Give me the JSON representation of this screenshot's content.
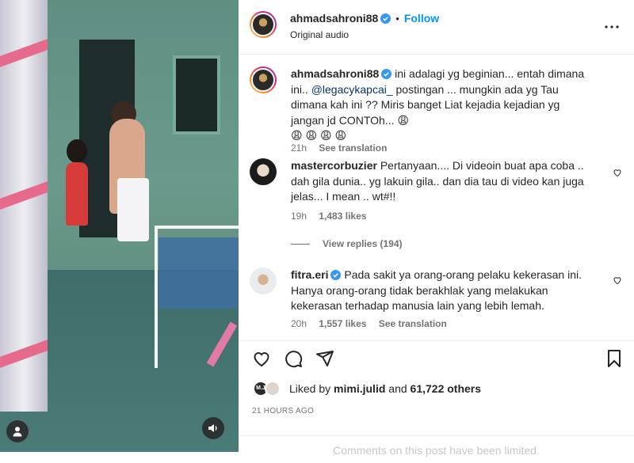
{
  "post": {
    "author": "ahmadsahroni88",
    "follow_label": "Follow",
    "dot": "•",
    "audio": "Original audio",
    "more_icon": "more-horizontal-icon"
  },
  "caption": {
    "author": "ahmadsahroni88",
    "text_before_mention": "ini adalagi yg beginian... entah dimana ini..",
    "mention": "@legacykapcai_",
    "text_after_mention": "postingan ... mungkin ada yg Tau dimana kah ini ?? Miris banget Liat kejadia kejadian yg jangan jd CONTOh... 😩",
    "emojis": "😩 😩 😩 😩",
    "age": "21h",
    "see_translation": "See translation"
  },
  "comments": [
    {
      "author": "mastercorbuzier",
      "text": "Pertanyaan.... Di videoin buat apa coba .. dah gila dunia.. yg lakuin gila.. dan dia tau di video kan juga jelas... I mean .. wt#!!",
      "age": "19h",
      "likes": "1,483 likes",
      "view_replies": "View replies (194)"
    },
    {
      "author": "fitra.eri",
      "text": "Pada sakit ya orang-orang pelaku kekerasan ini. Hanya orang-orang tidak berakhlak yang melakukan kekerasan terhadap manusia lain yang lebih lemah.",
      "age": "20h",
      "likes": "1,557 likes",
      "see_translation": "See translation"
    }
  ],
  "actions": {
    "like_icon": "heart-icon",
    "comment_icon": "comment-icon",
    "share_icon": "send-icon",
    "save_icon": "bookmark-icon"
  },
  "likes": {
    "prefix": "Liked by",
    "user": "mimi.julid",
    "middle": "and",
    "others": "61,722 others",
    "avatar_label": "M.J"
  },
  "timestamp": "21 hours ago",
  "limited_notice": "Comments on this post have been limited.",
  "colors": {
    "accent": "#0095f6",
    "verified": "#3897f0",
    "text": "#262626",
    "secondary": "#737373"
  }
}
